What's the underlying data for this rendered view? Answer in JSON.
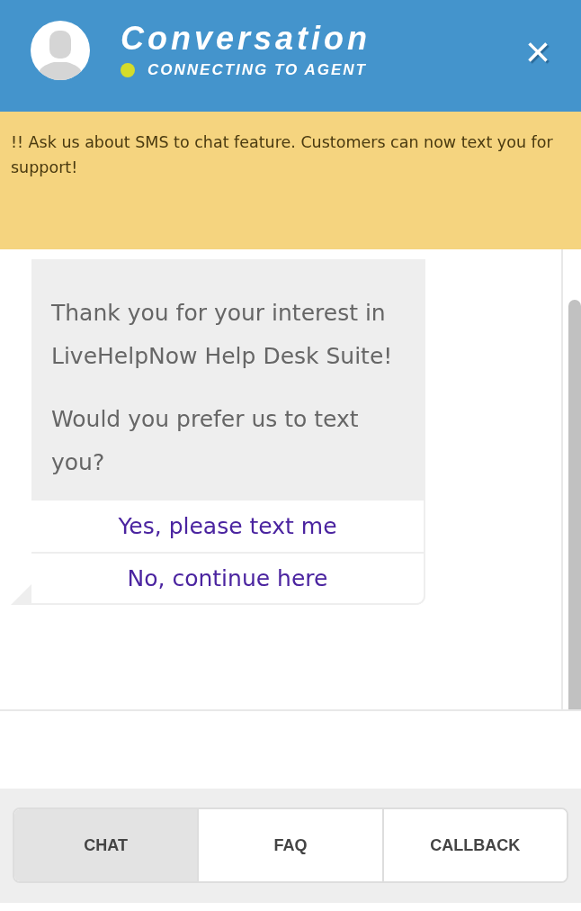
{
  "header": {
    "title": "Conversation",
    "status": "CONNECTING TO AGENT",
    "close": "×"
  },
  "banner": "!! Ask us about SMS to chat feature. Customers can now text you for support!",
  "message": {
    "paragraphs": [
      "Thank you for your interest in LiveHelpNow Help Desk Suite!",
      "Would you prefer us to text you?"
    ],
    "options": [
      "Yes, please text me",
      "No, continue here"
    ]
  },
  "tabs": [
    {
      "label": "CHAT",
      "selected": true
    },
    {
      "label": "FAQ",
      "selected": false
    },
    {
      "label": "CALLBACK",
      "selected": false
    }
  ]
}
